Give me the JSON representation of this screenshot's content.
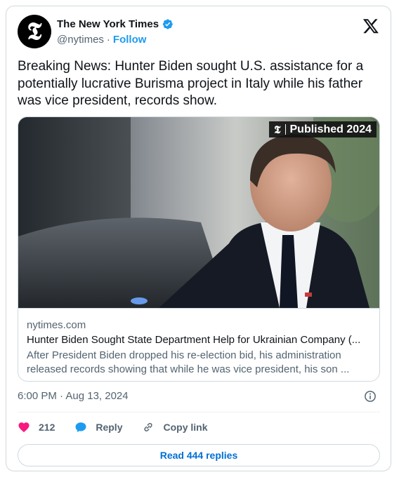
{
  "account": {
    "display_name": "The New York Times",
    "handle": "@nytimes",
    "separator": "·",
    "follow_label": "Follow",
    "avatar_glyph": "𝕿",
    "verified_color": "#1d9bf0"
  },
  "tweet": {
    "text": "Breaking News: Hunter Biden sought U.S. assistance for a potentially lucrative Burisma project in Italy while his father was vice president, records show."
  },
  "media": {
    "badge_logo": "𝕿",
    "badge_text": "Published 2024"
  },
  "link_card": {
    "domain": "nytimes.com",
    "title": "Hunter Biden Sought State Department Help for Ukrainian Company (...",
    "description": "After President Biden dropped his re-election bid, his administration released records showing that while he was vice president, his son ..."
  },
  "meta": {
    "timestamp": "6:00 PM · Aug 13, 2024"
  },
  "actions": {
    "like_count": "212",
    "reply_label": "Reply",
    "copy_link_label": "Copy link"
  },
  "replies_button": {
    "label": "Read 444 replies"
  },
  "icons": {
    "brand": "x-logo-icon",
    "verified": "verified-badge-icon",
    "info": "info-icon",
    "like": "heart-icon",
    "reply": "speech-bubble-icon",
    "copy": "link-icon"
  },
  "colors": {
    "like": "#f91880",
    "reply": "#1d9bf0",
    "link_accent": "#006fd6",
    "text_secondary": "#536471"
  }
}
